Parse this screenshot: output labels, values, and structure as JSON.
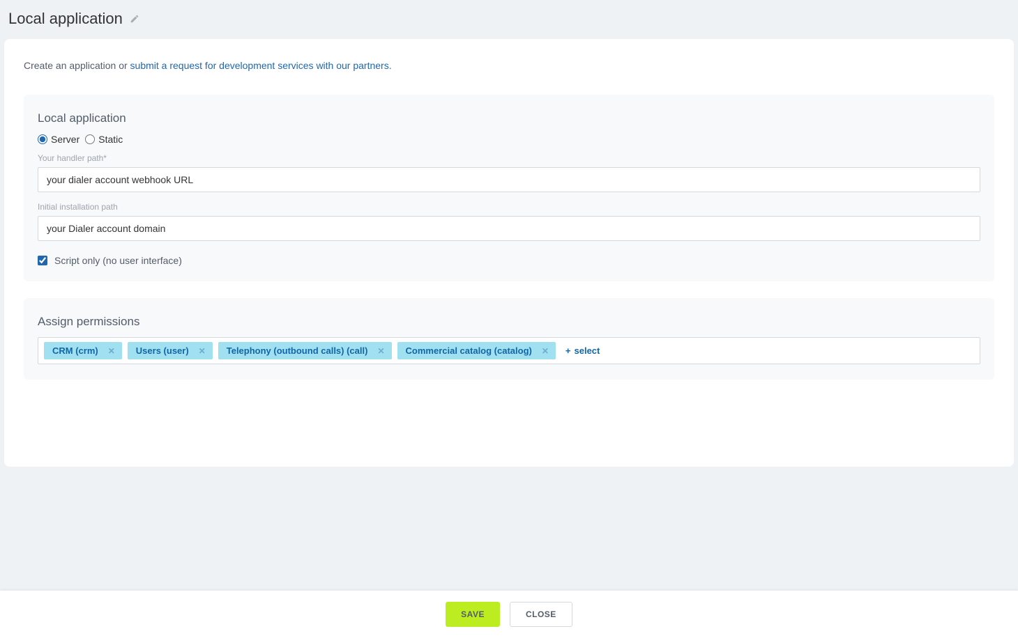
{
  "header": {
    "title": "Local application"
  },
  "intro": {
    "prefix": "Create an application or ",
    "link": "submit a request for development services with our partners",
    "suffix": "."
  },
  "local_app": {
    "section_title": "Local application",
    "radio_server": "Server",
    "radio_static": "Static",
    "handler_path_label": "Your handler path*",
    "handler_path_value": "your dialer account webhook URL",
    "install_path_label": "Initial installation path",
    "install_path_value": "your Dialer account domain",
    "script_only_label": "Script only (no user interface)"
  },
  "permissions": {
    "section_title": "Assign permissions",
    "tags": [
      "CRM (crm)",
      "Users (user)",
      "Telephony (outbound calls) (call)",
      "Commercial catalog (catalog)"
    ],
    "add_label": "select"
  },
  "footer": {
    "save": "SAVE",
    "close": "CLOSE"
  }
}
